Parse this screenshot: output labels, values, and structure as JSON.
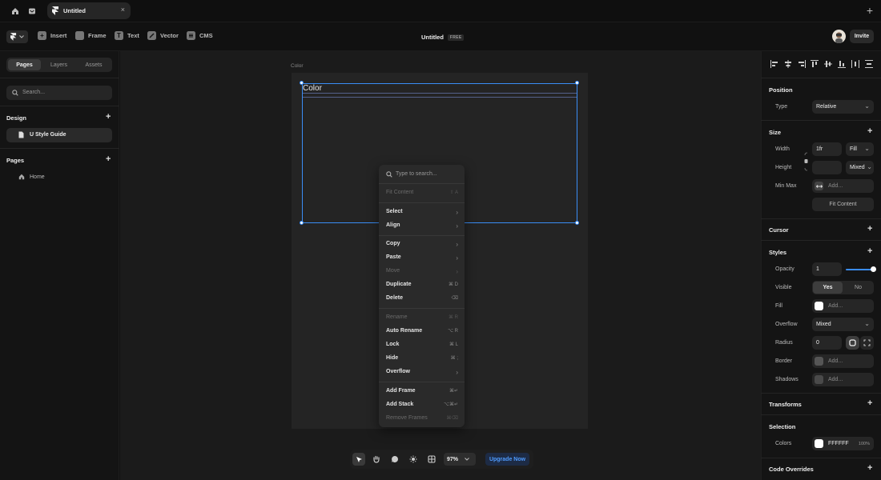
{
  "tabbar": {
    "tab_title": "Untitled",
    "close": "×",
    "add": "+"
  },
  "toolbar": {
    "insert": "Insert",
    "frame": "Frame",
    "text": "Text",
    "vector": "Vector",
    "cms": "CMS",
    "doc_title": "Untitled",
    "doc_badge": "FREE",
    "invite": "Invite"
  },
  "left": {
    "tabs": [
      "Pages",
      "Layers",
      "Assets"
    ],
    "search_placeholder": "Search...",
    "design_heading": "Design",
    "design_item": "U Style Guide",
    "pages_heading": "Pages",
    "home": "Home"
  },
  "canvas": {
    "frame_label": "Color",
    "frame_title": "Color"
  },
  "context_menu": {
    "search_placeholder": "Type to search...",
    "items": [
      {
        "label": "Fit Content",
        "shortcut": "⇧ A",
        "disabled": true
      },
      {
        "label": "Select",
        "shortcut": "›",
        "disabled": false
      },
      {
        "label": "Align",
        "shortcut": "›",
        "disabled": false
      },
      {
        "label": "Copy",
        "shortcut": "›",
        "disabled": false
      },
      {
        "label": "Paste",
        "shortcut": "›",
        "disabled": false
      },
      {
        "label": "Move",
        "shortcut": "›",
        "disabled": true
      },
      {
        "label": "Duplicate",
        "shortcut": "⌘ D",
        "disabled": false
      },
      {
        "label": "Delete",
        "shortcut": "⌫",
        "disabled": false
      },
      {
        "label": "Rename",
        "shortcut": "⌘ R",
        "disabled": true
      },
      {
        "label": "Auto Rename",
        "shortcut": "⌥ R",
        "disabled": false
      },
      {
        "label": "Lock",
        "shortcut": "⌘ L",
        "disabled": false
      },
      {
        "label": "Hide",
        "shortcut": "⌘ ;",
        "disabled": false
      },
      {
        "label": "Overflow",
        "shortcut": "›",
        "disabled": false
      },
      {
        "label": "Add Frame",
        "shortcut": "⌘↵",
        "disabled": false
      },
      {
        "label": "Add Stack",
        "shortcut": "⌥⌘↵",
        "disabled": false
      },
      {
        "label": "Remove Frames",
        "shortcut": "⌘⌫",
        "disabled": true
      }
    ]
  },
  "bottom": {
    "zoom": "97%",
    "upgrade": "Upgrade Now"
  },
  "right": {
    "position": "Position",
    "type_label": "Type",
    "type_value": "Relative",
    "size": "Size",
    "width_label": "Width",
    "width_value": "1fr",
    "width_mode": "Fill",
    "height_label": "Height",
    "height_value": "",
    "height_mode": "Mixed",
    "minmax_label": "Min Max",
    "minmax_placeholder": "Add...",
    "fit_content": "Fit Content",
    "cursor": "Cursor",
    "styles": "Styles",
    "opacity_label": "Opacity",
    "opacity_value": "1",
    "opacity_level": 1.0,
    "visible_label": "Visible",
    "visible_yes": "Yes",
    "visible_no": "No",
    "fill_label": "Fill",
    "fill_placeholder": "Add...",
    "overflow_label": "Overflow",
    "overflow_value": "Mixed",
    "radius_label": "Radius",
    "radius_value": "0",
    "border_label": "Border",
    "border_placeholder": "Add...",
    "shadows_label": "Shadows",
    "shadows_placeholder": "Add...",
    "transforms": "Transforms",
    "selection": "Selection",
    "colors_label": "Colors",
    "colors_hex": "FFFFFF",
    "colors_pct": "100%",
    "code_overrides": "Code Overrides"
  },
  "colors": {
    "accent": "#3a8df5",
    "selection_swatch": "#FFFFFF"
  }
}
